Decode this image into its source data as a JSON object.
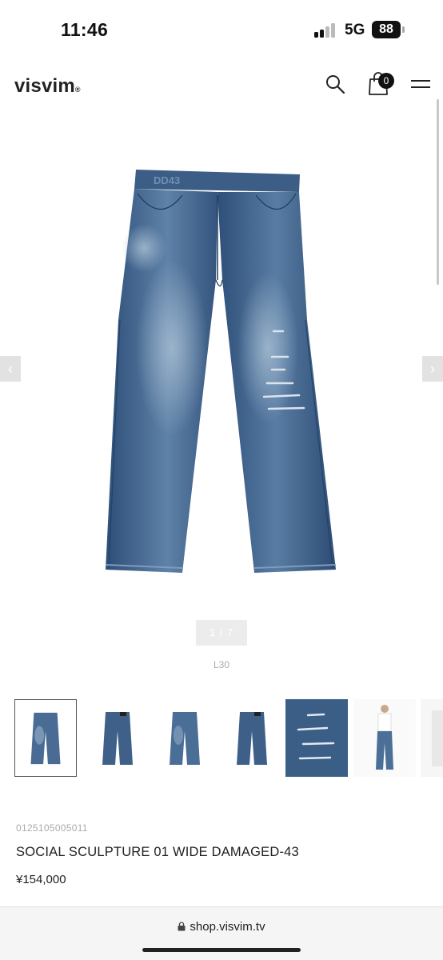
{
  "status": {
    "time": "11:46",
    "network": "5G",
    "battery": "88"
  },
  "header": {
    "logo": "visvim",
    "logo_mark": "®",
    "cart_count": "0"
  },
  "gallery": {
    "counter": "1 / 7",
    "prev_glyph": "‹",
    "next_glyph": "›",
    "size_label": "L30",
    "waistband_text": "DD43"
  },
  "product": {
    "code": "0125105005011",
    "name": "SOCIAL SCULPTURE 01 WIDE DAMAGED-43",
    "price": "¥154,000"
  },
  "browser": {
    "url": "shop.visvim.tv"
  },
  "colors": {
    "denim_dark": "#2f4f76",
    "denim_mid": "#4a6f98",
    "denim_light": "#8fa9c3",
    "accent": "#111111"
  }
}
